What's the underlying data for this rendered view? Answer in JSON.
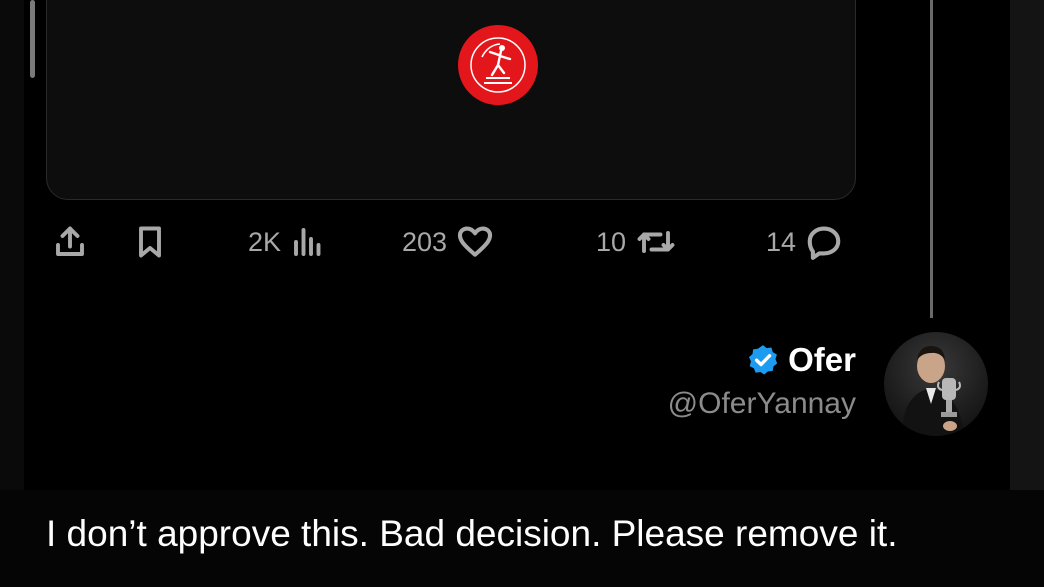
{
  "quoted_card": {
    "logo_name": "club-crest-icon",
    "logo_color": "#e3171b"
  },
  "actions": {
    "share_icon": "share-icon",
    "bookmark_icon": "bookmark-icon",
    "views": {
      "count": "2K",
      "icon": "views-icon"
    },
    "likes": {
      "count": "203",
      "icon": "heart-icon"
    },
    "reposts": {
      "count": "10",
      "icon": "repost-icon"
    },
    "replies": {
      "count": "14",
      "icon": "reply-icon"
    }
  },
  "author": {
    "name": "Ofer",
    "handle": "@OferYannay",
    "verified": true,
    "verified_color": "#1d9bf0"
  },
  "tweet": {
    "text": "I don’t approve this. Bad decision. Please remove it."
  }
}
